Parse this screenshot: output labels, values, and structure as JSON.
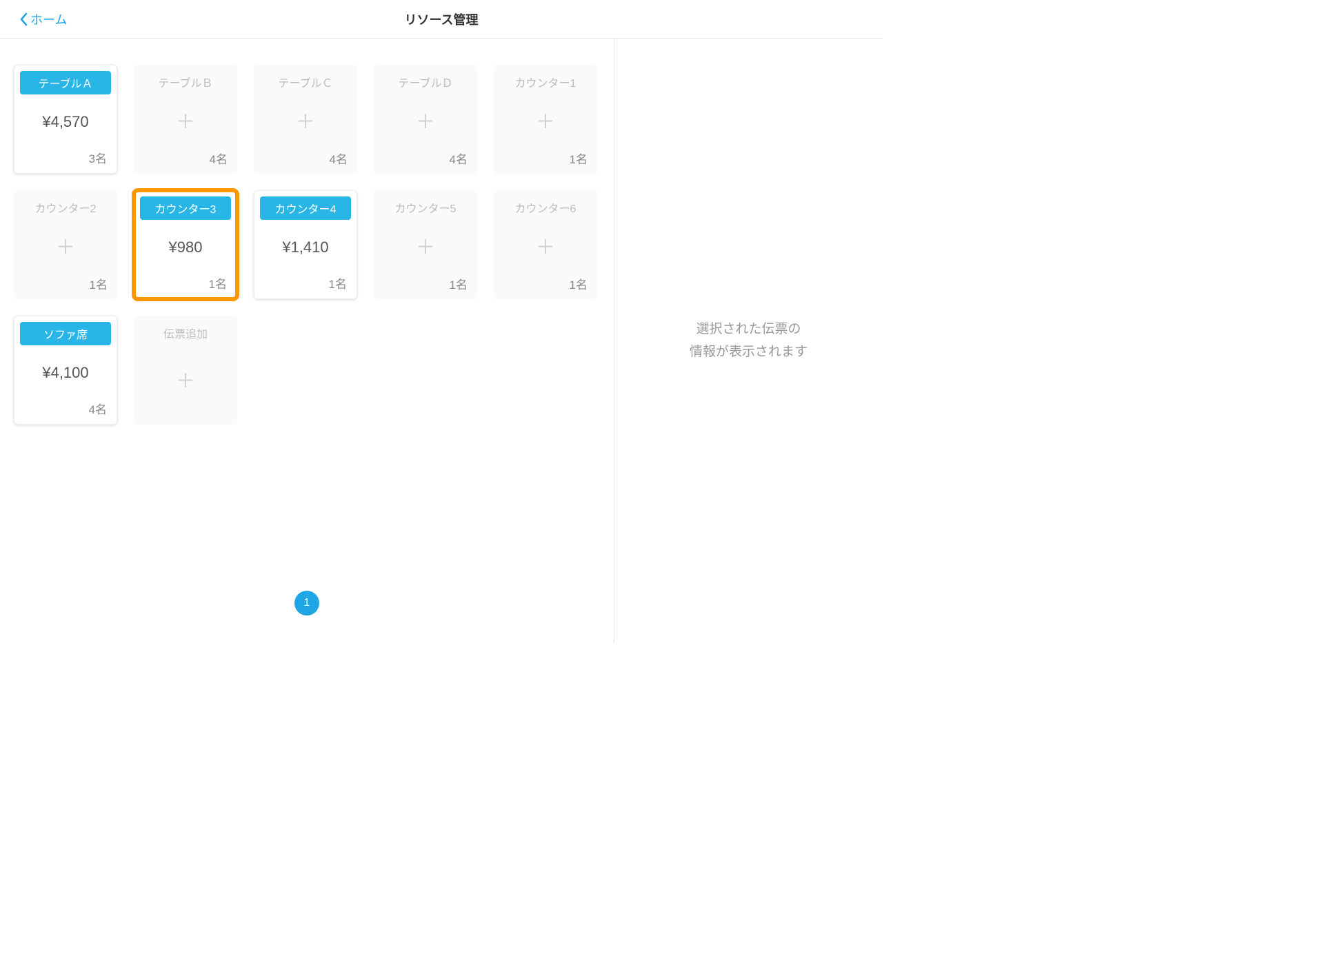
{
  "header": {
    "back_label": "ホーム",
    "title": "リソース管理"
  },
  "tiles": [
    {
      "label": "テーブルＡ",
      "price": "¥4,570",
      "capacity": "3名",
      "state": "active",
      "highlighted": false
    },
    {
      "label": "テーブルＢ",
      "price": "",
      "capacity": "4名",
      "state": "empty",
      "highlighted": false
    },
    {
      "label": "テーブルＣ",
      "price": "",
      "capacity": "4名",
      "state": "empty",
      "highlighted": false
    },
    {
      "label": "テーブルＤ",
      "price": "",
      "capacity": "4名",
      "state": "empty",
      "highlighted": false
    },
    {
      "label": "カウンター1",
      "price": "",
      "capacity": "1名",
      "state": "empty",
      "highlighted": false
    },
    {
      "label": "カウンター2",
      "price": "",
      "capacity": "1名",
      "state": "empty",
      "highlighted": false
    },
    {
      "label": "カウンター3",
      "price": "¥980",
      "capacity": "1名",
      "state": "active",
      "highlighted": true
    },
    {
      "label": "カウンター4",
      "price": "¥1,410",
      "capacity": "1名",
      "state": "active",
      "highlighted": false
    },
    {
      "label": "カウンター5",
      "price": "",
      "capacity": "1名",
      "state": "empty",
      "highlighted": false
    },
    {
      "label": "カウンター6",
      "price": "",
      "capacity": "1名",
      "state": "empty",
      "highlighted": false
    },
    {
      "label": "ソファ席",
      "price": "¥4,100",
      "capacity": "4名",
      "state": "active",
      "highlighted": false
    },
    {
      "label": "伝票追加",
      "price": "",
      "capacity": "",
      "state": "add",
      "highlighted": false
    }
  ],
  "pager": {
    "page": "1"
  },
  "sidebar": {
    "message_line1": "選択された伝票の",
    "message_line2": "情報が表示されます"
  }
}
